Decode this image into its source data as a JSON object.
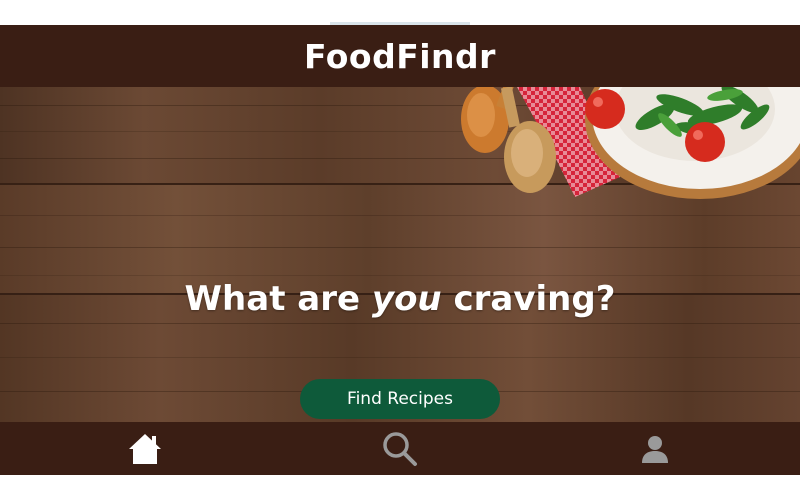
{
  "app": {
    "title": "FoodFindr"
  },
  "hero": {
    "heading_before": "What are ",
    "heading_emphasis": "you",
    "heading_after": " craving?",
    "cta_label": "Find Recipes"
  },
  "nav": {
    "items": [
      {
        "icon": "home-icon",
        "active": true
      },
      {
        "icon": "search-icon",
        "active": false
      },
      {
        "icon": "profile-icon",
        "active": false
      }
    ]
  },
  "colors": {
    "header_bg": "#3a1e14",
    "button_bg": "#0e5a3a",
    "active_icon": "#ffffff",
    "inactive_icon": "#9a9a9a"
  }
}
